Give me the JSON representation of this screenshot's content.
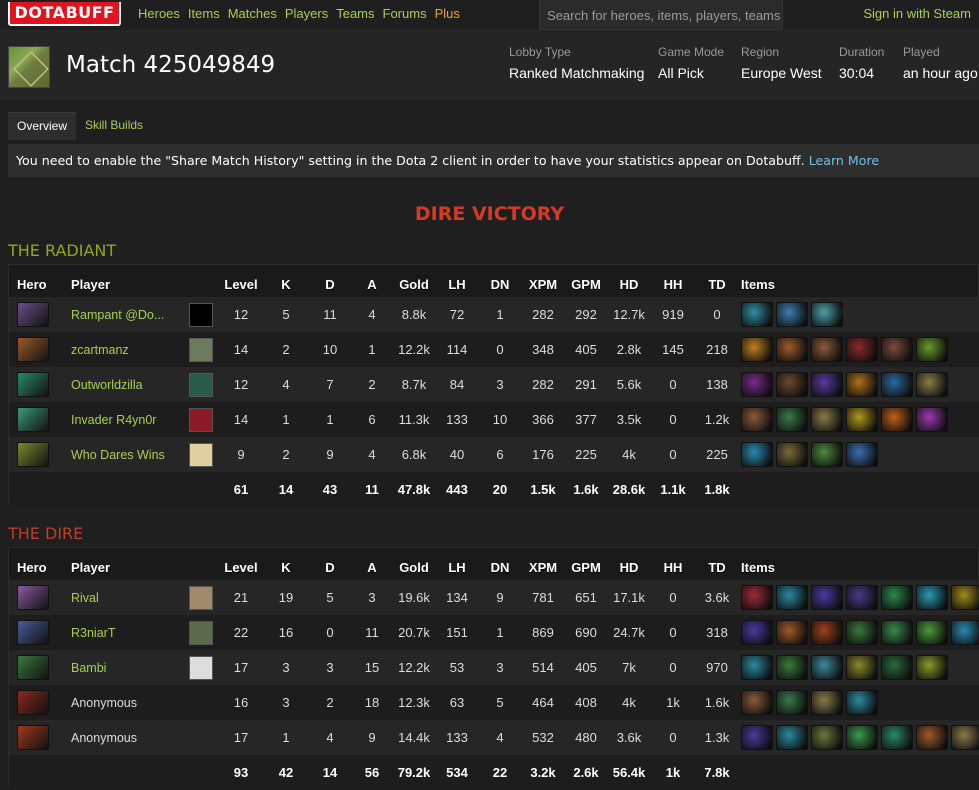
{
  "nav": {
    "logo": "DOTABUFF",
    "links": [
      "Heroes",
      "Items",
      "Matches",
      "Players",
      "Teams",
      "Forums"
    ],
    "plus": "Plus",
    "search_placeholder": "Search for heroes, items, players, teams",
    "signin": "Sign in with Steam"
  },
  "match": {
    "title": "Match 425049849",
    "meta": [
      {
        "label": "Lobby Type",
        "value": "Ranked Matchmaking"
      },
      {
        "label": "Game Mode",
        "value": "All Pick"
      },
      {
        "label": "Region",
        "value": "Europe West"
      },
      {
        "label": "Duration",
        "value": "30:04"
      },
      {
        "label": "Played",
        "value": "an hour ago"
      }
    ]
  },
  "tabs": [
    "Overview",
    "Skill Builds"
  ],
  "notice": {
    "text": "You need to enable the \"Share Match History\" setting in the Dota 2 client in order to have your statistics appear on Dotabuff. ",
    "link": "Learn More"
  },
  "result": "DIRE VICTORY",
  "columns": [
    "Hero",
    "Player",
    "Level",
    "K",
    "D",
    "A",
    "Gold",
    "LH",
    "DN",
    "XPM",
    "GPM",
    "HD",
    "HH",
    "TD",
    "Items"
  ],
  "radiant": {
    "name": "THE RADIANT",
    "players": [
      {
        "hero_color": "#6a4f8c",
        "avatar_color": "#000",
        "player": "Rampant @Do...",
        "level": "12",
        "k": "5",
        "d": "11",
        "a": "4",
        "gold": "8.8k",
        "lh": "72",
        "dn": "1",
        "xpm": "282",
        "gpm": "292",
        "hd": "12.7k",
        "hh": "919",
        "td": "0",
        "items": [
          "#2f8fa0",
          "#3a7fb0",
          "#4aa0a8"
        ]
      },
      {
        "hero_color": "#9a5a2a",
        "avatar_color": "#6a7a5a",
        "player": "zcartmanz",
        "level": "14",
        "k": "2",
        "d": "10",
        "a": "1",
        "gold": "12.2k",
        "lh": "114",
        "dn": "0",
        "xpm": "348",
        "gpm": "405",
        "hd": "2.8k",
        "hh": "145",
        "td": "218",
        "items": [
          "#c0801f",
          "#a05a2a",
          "#8a5a3a",
          "#8a2a2a",
          "#7a4a3a",
          "#6a9a2a"
        ]
      },
      {
        "hero_color": "#2a8a6a",
        "avatar_color": "#2a5a4a",
        "player": "Outworldzilla",
        "level": "12",
        "k": "4",
        "d": "7",
        "a": "2",
        "gold": "8.7k",
        "lh": "84",
        "dn": "3",
        "xpm": "282",
        "gpm": "291",
        "hd": "5.6k",
        "hh": "0",
        "td": "138",
        "items": [
          "#7a2a8a",
          "#6a4a2a",
          "#5a3aa0",
          "#b0701a",
          "#2a6aa0",
          "#8a7a4a"
        ]
      },
      {
        "hero_color": "#3a9a7a",
        "avatar_color": "#8a1a2a",
        "player": "Invader R4yn0r",
        "level": "14",
        "k": "1",
        "d": "1",
        "a": "6",
        "gold": "11.3k",
        "lh": "133",
        "dn": "10",
        "xpm": "366",
        "gpm": "377",
        "hd": "3.5k",
        "hh": "0",
        "td": "1.2k",
        "items": [
          "#8a5a3a",
          "#3a7a4a",
          "#8a7a4a",
          "#b09a1a",
          "#c0601a",
          "#9a3ab0"
        ]
      },
      {
        "hero_color": "#7a8a2a",
        "avatar_color": "#e0d0a0",
        "player": "Who Dares Wins",
        "level": "9",
        "k": "2",
        "d": "9",
        "a": "4",
        "gold": "6.8k",
        "lh": "40",
        "dn": "6",
        "xpm": "176",
        "gpm": "225",
        "hd": "4k",
        "hh": "0",
        "td": "225",
        "items": [
          "#2a8ab0",
          "#7a6a3a",
          "#4a8a3a",
          "#3a70b0"
        ]
      }
    ],
    "totals": {
      "level": "61",
      "k": "14",
      "d": "43",
      "a": "11",
      "gold": "47.8k",
      "lh": "443",
      "dn": "20",
      "xpm": "1.5k",
      "gpm": "1.6k",
      "hd": "28.6k",
      "hh": "1.1k",
      "td": "1.8k"
    }
  },
  "dire": {
    "name": "THE DIRE",
    "players": [
      {
        "hero_color": "#8a5aa0",
        "avatar_color": "#a08a6a",
        "player": "Rival",
        "level": "21",
        "k": "19",
        "d": "5",
        "a": "3",
        "gold": "19.6k",
        "lh": "134",
        "dn": "9",
        "xpm": "781",
        "gpm": "651",
        "hd": "17.1k",
        "hh": "0",
        "td": "3.6k",
        "items": [
          "#a02a3a",
          "#2a8aa0",
          "#4a3aa0",
          "#4a3a8a",
          "#2a8a4a",
          "#2a9ab0",
          "#a08a1a"
        ]
      },
      {
        "hero_color": "#4a5a9a",
        "avatar_color": "#5a6a4a",
        "player": "R3niarT",
        "level": "22",
        "k": "16",
        "d": "0",
        "a": "11",
        "gold": "20.7k",
        "lh": "151",
        "dn": "1",
        "xpm": "869",
        "gpm": "690",
        "hd": "24.7k",
        "hh": "0",
        "td": "318",
        "items": [
          "#4a3aa0",
          "#a05a2a",
          "#a0401a",
          "#3a7a3a",
          "#3a8a4a",
          "#4a9a3a",
          "#2a8ab0"
        ]
      },
      {
        "hero_color": "#3a7a3a",
        "avatar_color": "#ddd",
        "player": "Bambi",
        "level": "17",
        "k": "3",
        "d": "3",
        "a": "15",
        "gold": "12.2k",
        "lh": "53",
        "dn": "3",
        "xpm": "514",
        "gpm": "405",
        "hd": "7k",
        "hh": "0",
        "td": "970",
        "items": [
          "#2a8aa0",
          "#3a7a3a",
          "#3a8a9a",
          "#8a8a2a",
          "#2a6a3a",
          "#8a9a2a"
        ]
      },
      {
        "hero_color": "#8a2a1a",
        "avatar_color": "",
        "player": "Anonymous",
        "level": "16",
        "k": "3",
        "d": "2",
        "a": "18",
        "gold": "12.3k",
        "lh": "63",
        "dn": "5",
        "xpm": "464",
        "gpm": "408",
        "hd": "4k",
        "hh": "1k",
        "td": "1.6k",
        "items": [
          "#8a5a3a",
          "#3a7a4a",
          "#8a7a4a",
          "#2a8aa0"
        ]
      },
      {
        "hero_color": "#a03a1a",
        "avatar_color": "",
        "player": "Anonymous",
        "level": "17",
        "k": "1",
        "d": "4",
        "a": "9",
        "gold": "14.4k",
        "lh": "133",
        "dn": "4",
        "xpm": "532",
        "gpm": "480",
        "hd": "3.6k",
        "hh": "0",
        "td": "1.3k",
        "items": [
          "#4a3aa0",
          "#2a8aa0",
          "#6a7a3a",
          "#3a9a4a",
          "#2a8a6a",
          "#a05a2a",
          "#8a7a4a"
        ]
      }
    ],
    "totals": {
      "level": "93",
      "k": "42",
      "d": "14",
      "a": "56",
      "gold": "79.2k",
      "lh": "534",
      "dn": "22",
      "xpm": "3.2k",
      "gpm": "2.6k",
      "hd": "56.4k",
      "hh": "1k",
      "td": "7.8k"
    }
  }
}
